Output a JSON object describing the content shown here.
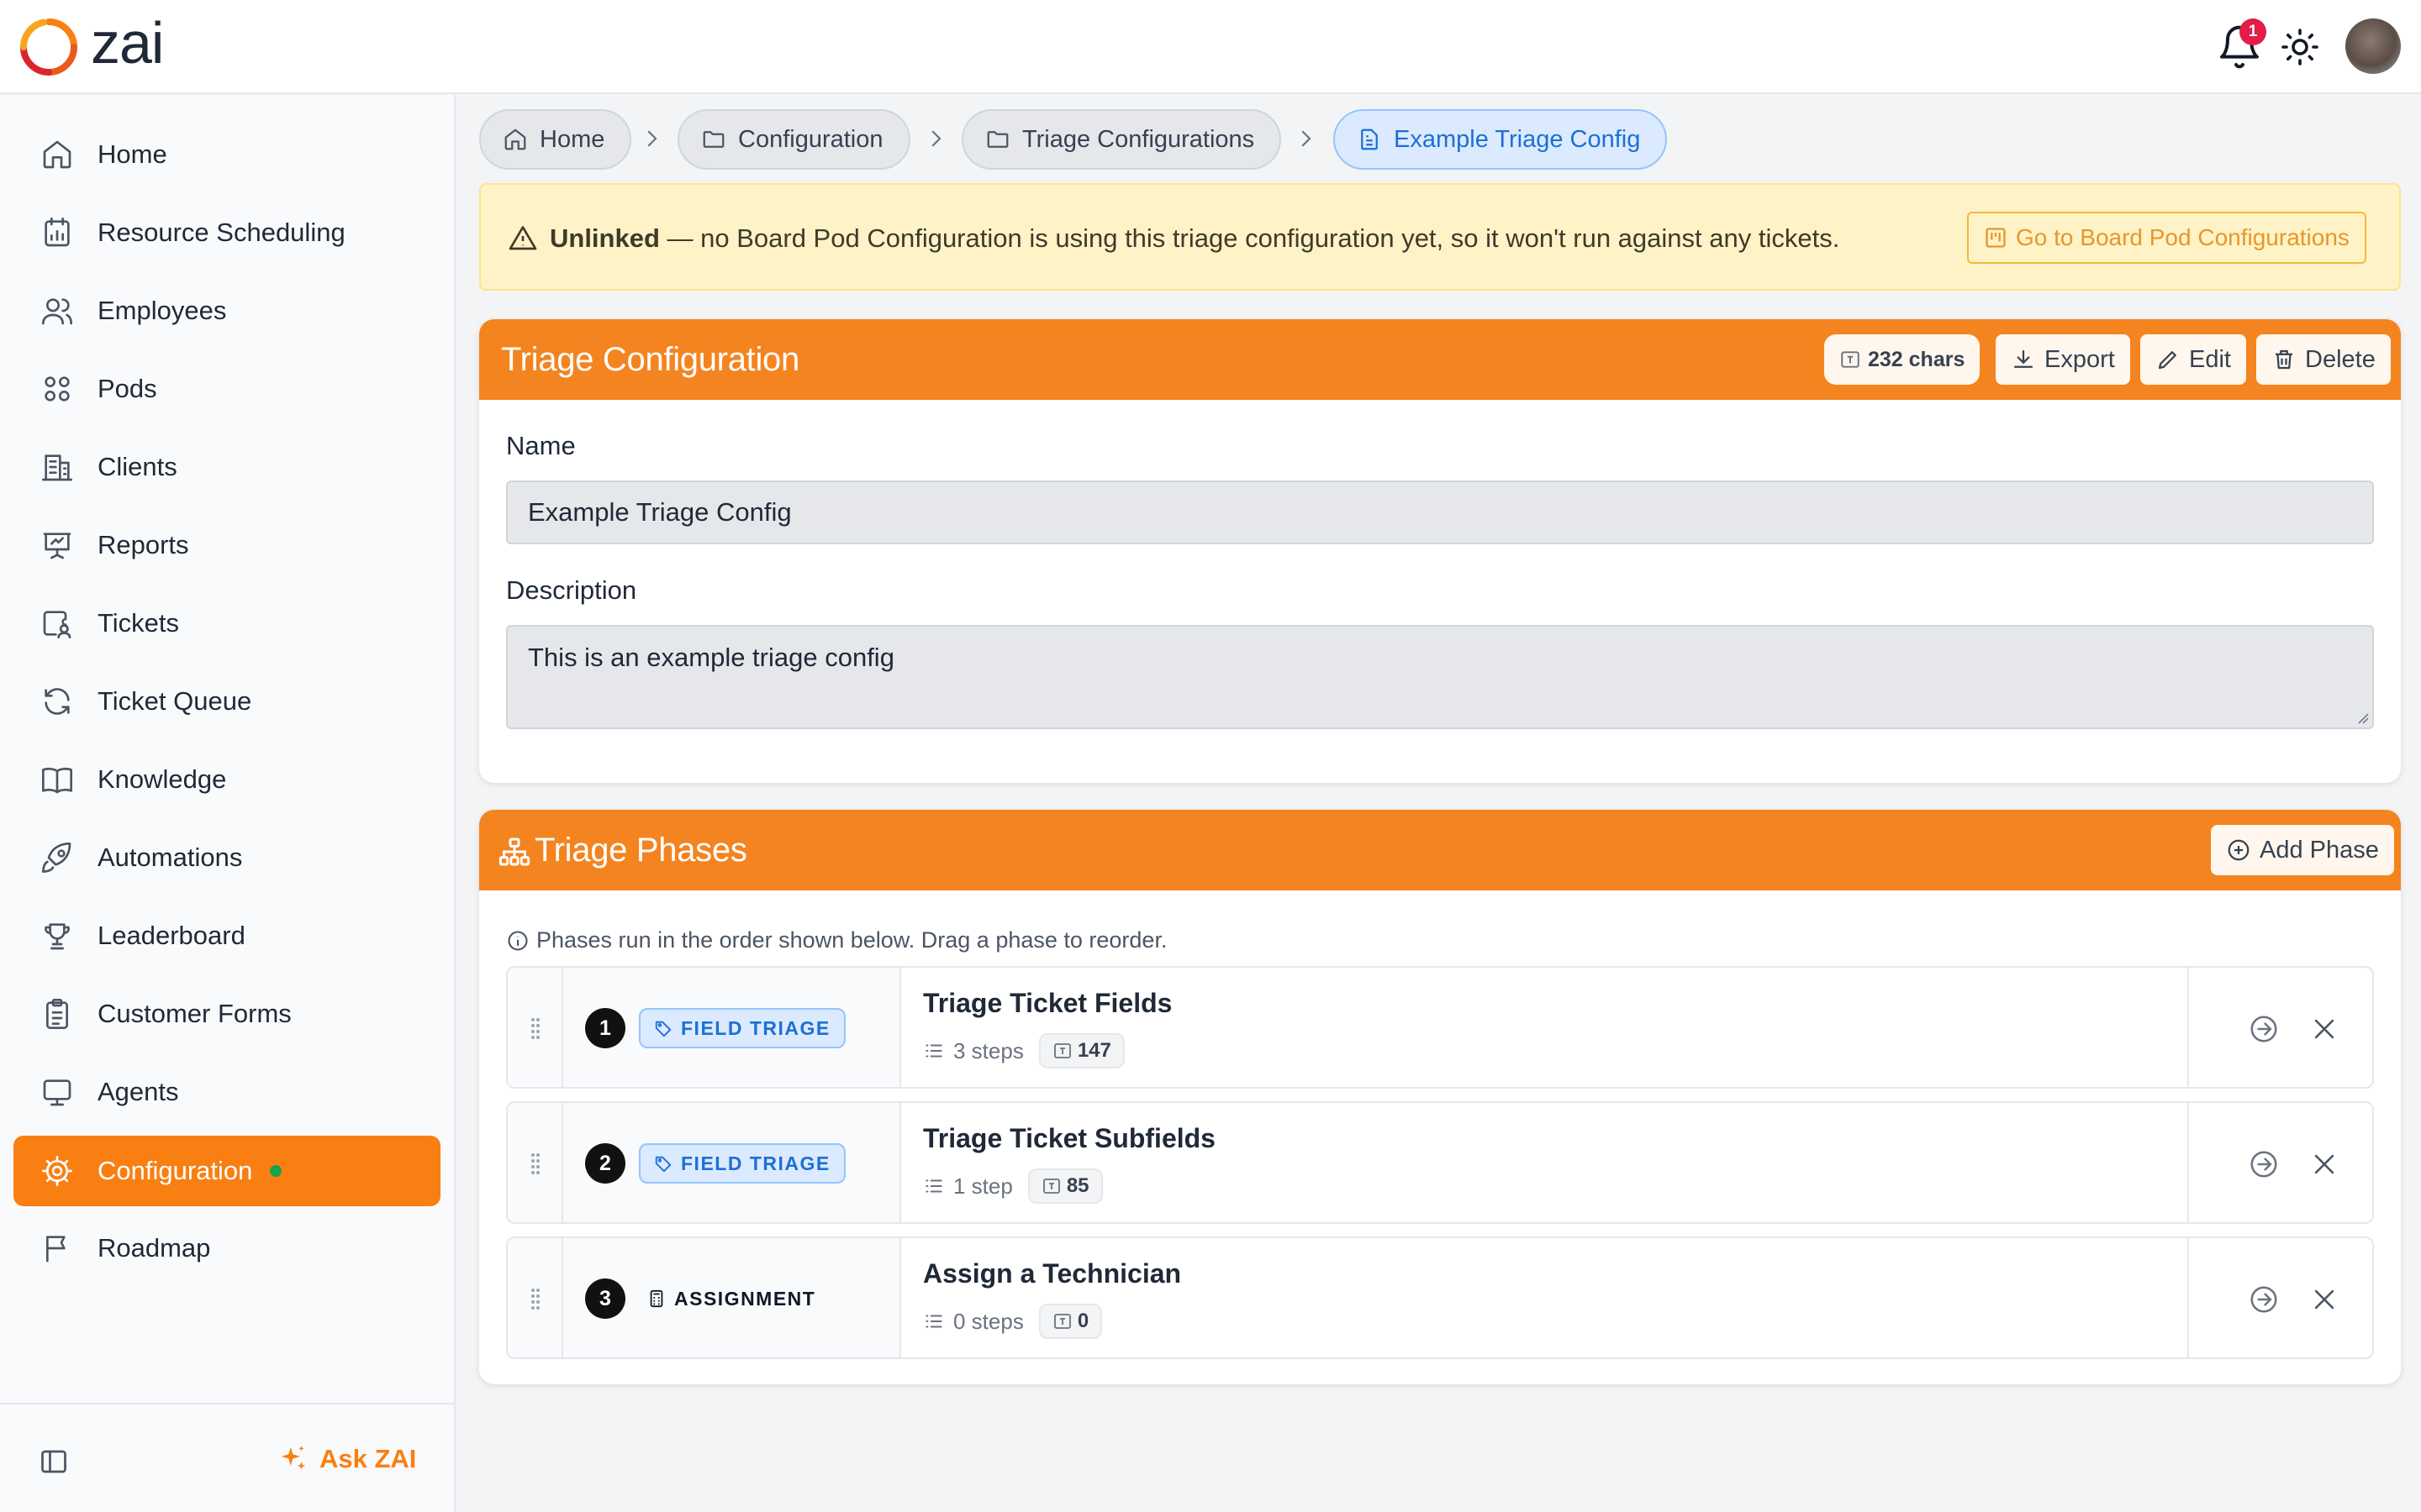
{
  "app": {
    "logo_text": "zai",
    "notification_count": "1",
    "accent_color": "#f97f13"
  },
  "sidebar": {
    "items": [
      {
        "label": "Home",
        "icon": "home-icon"
      },
      {
        "label": "Resource Scheduling",
        "icon": "calendar-chart-icon"
      },
      {
        "label": "Employees",
        "icon": "users-icon"
      },
      {
        "label": "Pods",
        "icon": "grid-icon"
      },
      {
        "label": "Clients",
        "icon": "building-icon"
      },
      {
        "label": "Reports",
        "icon": "presentation-icon"
      },
      {
        "label": "Tickets",
        "icon": "ticket-user-icon"
      },
      {
        "label": "Ticket Queue",
        "icon": "refresh-icon"
      },
      {
        "label": "Knowledge",
        "icon": "book-icon"
      },
      {
        "label": "Automations",
        "icon": "rocket-icon"
      },
      {
        "label": "Leaderboard",
        "icon": "trophy-icon"
      },
      {
        "label": "Customer Forms",
        "icon": "clipboard-icon"
      },
      {
        "label": "Agents",
        "icon": "monitor-icon"
      },
      {
        "label": "Configuration",
        "icon": "gear-icon",
        "active": true
      },
      {
        "label": "Roadmap",
        "icon": "flag-icon"
      }
    ],
    "ask_label": "Ask ZAI"
  },
  "breadcrumb": [
    "Home",
    "Configuration",
    "Triage Configurations",
    "Example Triage Config"
  ],
  "banner": {
    "strong": "Unlinked",
    "text": " — no Board Pod Configuration is using this triage configuration yet, so it won't run against any tickets.",
    "button": "Go to Board Pod Configurations"
  },
  "config_card": {
    "title": "Triage Configuration",
    "chars": "232 chars",
    "export_label": "Export",
    "edit_label": "Edit",
    "delete_label": "Delete",
    "name_label": "Name",
    "name_value": "Example Triage Config",
    "description_label": "Description",
    "description_value": "This is an example triage config"
  },
  "phases_card": {
    "title": "Triage Phases",
    "add_label": "Add Phase",
    "info": "Phases run in the order shown below. Drag a phase to reorder.",
    "phases": [
      {
        "num": "1",
        "type": "FIELD TRIAGE",
        "title": "Triage Ticket Fields",
        "steps": "3 steps",
        "count": "147"
      },
      {
        "num": "2",
        "type": "FIELD TRIAGE",
        "title": "Triage Ticket Subfields",
        "steps": "1 step",
        "count": "85"
      },
      {
        "num": "3",
        "type": "ASSIGNMENT",
        "title": "Assign a Technician",
        "steps": "0 steps",
        "count": "0"
      }
    ]
  }
}
